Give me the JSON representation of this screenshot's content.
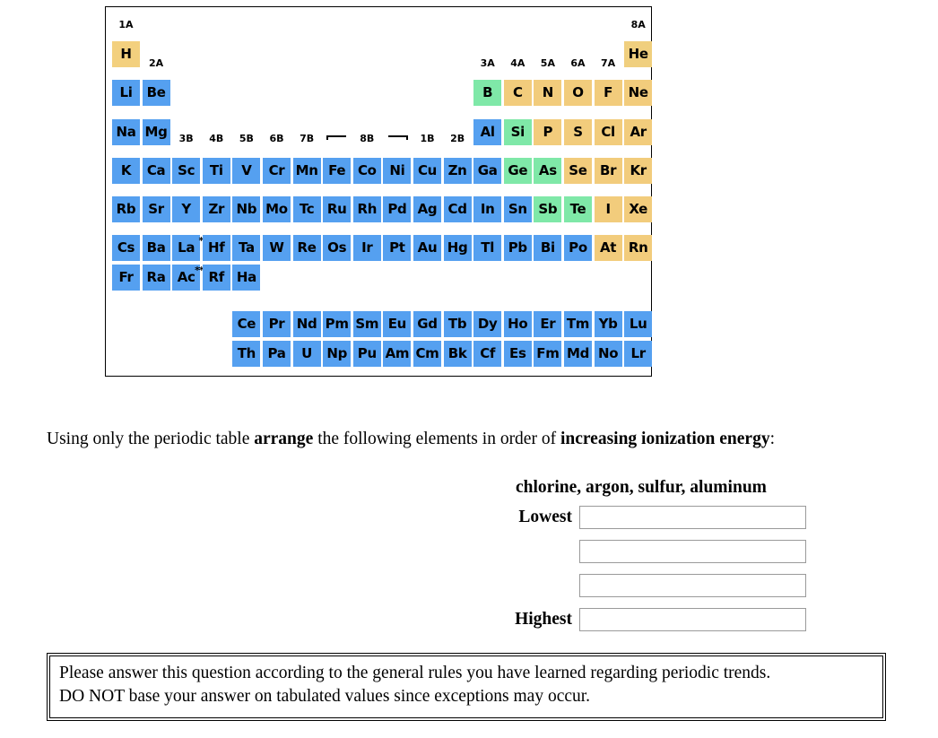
{
  "periodic_table": {
    "legend_colors": {
      "metal": "#55a0f0",
      "metalloid": "#7fe8a8",
      "nonmetal": "#f2cc7c",
      "noble_gas": "#f0cf7e"
    },
    "group_labels": [
      {
        "label": "1A",
        "col": 0,
        "row": "top"
      },
      {
        "label": "2A",
        "col": 1,
        "row": "h"
      },
      {
        "label": "3B",
        "col": 2,
        "row": "na"
      },
      {
        "label": "4B",
        "col": 3,
        "row": "na"
      },
      {
        "label": "5B",
        "col": 4,
        "row": "na"
      },
      {
        "label": "6B",
        "col": 5,
        "row": "na"
      },
      {
        "label": "7B",
        "col": 6,
        "row": "na"
      },
      {
        "label": "8B",
        "col": 8,
        "row": "na"
      },
      {
        "label": "1B",
        "col": 10,
        "row": "na"
      },
      {
        "label": "2B",
        "col": 11,
        "row": "na"
      },
      {
        "label": "3A",
        "col": 12,
        "row": "he"
      },
      {
        "label": "4A",
        "col": 13,
        "row": "he"
      },
      {
        "label": "5A",
        "col": 14,
        "row": "he"
      },
      {
        "label": "6A",
        "col": 15,
        "row": "he"
      },
      {
        "label": "7A",
        "col": 16,
        "row": "he"
      },
      {
        "label": "8A",
        "col": 17,
        "row": "top"
      }
    ],
    "cells": [
      {
        "sym": "H",
        "col": 0,
        "row": 0,
        "type": "hyd"
      },
      {
        "sym": "He",
        "col": 17,
        "row": 0,
        "type": "noble"
      },
      {
        "sym": "Li",
        "col": 0,
        "row": 1,
        "type": "metal"
      },
      {
        "sym": "Be",
        "col": 1,
        "row": 1,
        "type": "metal"
      },
      {
        "sym": "B",
        "col": 12,
        "row": 1,
        "type": "metalloid"
      },
      {
        "sym": "C",
        "col": 13,
        "row": 1,
        "type": "nonmetal"
      },
      {
        "sym": "N",
        "col": 14,
        "row": 1,
        "type": "nonmetal"
      },
      {
        "sym": "O",
        "col": 15,
        "row": 1,
        "type": "nonmetal"
      },
      {
        "sym": "F",
        "col": 16,
        "row": 1,
        "type": "nonmetal"
      },
      {
        "sym": "Ne",
        "col": 17,
        "row": 1,
        "type": "nonmetal"
      },
      {
        "sym": "Na",
        "col": 0,
        "row": 2,
        "type": "metal"
      },
      {
        "sym": "Mg",
        "col": 1,
        "row": 2,
        "type": "metal"
      },
      {
        "sym": "Al",
        "col": 12,
        "row": 2,
        "type": "metal"
      },
      {
        "sym": "Si",
        "col": 13,
        "row": 2,
        "type": "metalloid"
      },
      {
        "sym": "P",
        "col": 14,
        "row": 2,
        "type": "nonmetal"
      },
      {
        "sym": "S",
        "col": 15,
        "row": 2,
        "type": "nonmetal"
      },
      {
        "sym": "Cl",
        "col": 16,
        "row": 2,
        "type": "nonmetal"
      },
      {
        "sym": "Ar",
        "col": 17,
        "row": 2,
        "type": "nonmetal"
      },
      {
        "sym": "K",
        "col": 0,
        "row": 3,
        "type": "metal"
      },
      {
        "sym": "Ca",
        "col": 1,
        "row": 3,
        "type": "metal"
      },
      {
        "sym": "Sc",
        "col": 2,
        "row": 3,
        "type": "metal"
      },
      {
        "sym": "Ti",
        "col": 3,
        "row": 3,
        "type": "metal"
      },
      {
        "sym": "V",
        "col": 4,
        "row": 3,
        "type": "metal"
      },
      {
        "sym": "Cr",
        "col": 5,
        "row": 3,
        "type": "metal"
      },
      {
        "sym": "Mn",
        "col": 6,
        "row": 3,
        "type": "metal"
      },
      {
        "sym": "Fe",
        "col": 7,
        "row": 3,
        "type": "metal"
      },
      {
        "sym": "Co",
        "col": 8,
        "row": 3,
        "type": "metal"
      },
      {
        "sym": "Ni",
        "col": 9,
        "row": 3,
        "type": "metal"
      },
      {
        "sym": "Cu",
        "col": 10,
        "row": 3,
        "type": "metal"
      },
      {
        "sym": "Zn",
        "col": 11,
        "row": 3,
        "type": "metal"
      },
      {
        "sym": "Ga",
        "col": 12,
        "row": 3,
        "type": "metal"
      },
      {
        "sym": "Ge",
        "col": 13,
        "row": 3,
        "type": "metalloid"
      },
      {
        "sym": "As",
        "col": 14,
        "row": 3,
        "type": "metalloid"
      },
      {
        "sym": "Se",
        "col": 15,
        "row": 3,
        "type": "nonmetal"
      },
      {
        "sym": "Br",
        "col": 16,
        "row": 3,
        "type": "nonmetal"
      },
      {
        "sym": "Kr",
        "col": 17,
        "row": 3,
        "type": "nonmetal"
      },
      {
        "sym": "Rb",
        "col": 0,
        "row": 4,
        "type": "metal"
      },
      {
        "sym": "Sr",
        "col": 1,
        "row": 4,
        "type": "metal"
      },
      {
        "sym": "Y",
        "col": 2,
        "row": 4,
        "type": "metal"
      },
      {
        "sym": "Zr",
        "col": 3,
        "row": 4,
        "type": "metal"
      },
      {
        "sym": "Nb",
        "col": 4,
        "row": 4,
        "type": "metal"
      },
      {
        "sym": "Mo",
        "col": 5,
        "row": 4,
        "type": "metal"
      },
      {
        "sym": "Tc",
        "col": 6,
        "row": 4,
        "type": "metal"
      },
      {
        "sym": "Ru",
        "col": 7,
        "row": 4,
        "type": "metal"
      },
      {
        "sym": "Rh",
        "col": 8,
        "row": 4,
        "type": "metal"
      },
      {
        "sym": "Pd",
        "col": 9,
        "row": 4,
        "type": "metal"
      },
      {
        "sym": "Ag",
        "col": 10,
        "row": 4,
        "type": "metal"
      },
      {
        "sym": "Cd",
        "col": 11,
        "row": 4,
        "type": "metal"
      },
      {
        "sym": "In",
        "col": 12,
        "row": 4,
        "type": "metal"
      },
      {
        "sym": "Sn",
        "col": 13,
        "row": 4,
        "type": "metal"
      },
      {
        "sym": "Sb",
        "col": 14,
        "row": 4,
        "type": "metalloid"
      },
      {
        "sym": "Te",
        "col": 15,
        "row": 4,
        "type": "metalloid"
      },
      {
        "sym": "I",
        "col": 16,
        "row": 4,
        "type": "nonmetal"
      },
      {
        "sym": "Xe",
        "col": 17,
        "row": 4,
        "type": "nonmetal"
      },
      {
        "sym": "Cs",
        "col": 0,
        "row": 5,
        "type": "metal"
      },
      {
        "sym": "Ba",
        "col": 1,
        "row": 5,
        "type": "metal"
      },
      {
        "sym": "La",
        "col": 2,
        "row": 5,
        "type": "metal",
        "mark": "*"
      },
      {
        "sym": "Hf",
        "col": 3,
        "row": 5,
        "type": "metal"
      },
      {
        "sym": "Ta",
        "col": 4,
        "row": 5,
        "type": "metal"
      },
      {
        "sym": "W",
        "col": 5,
        "row": 5,
        "type": "metal"
      },
      {
        "sym": "Re",
        "col": 6,
        "row": 5,
        "type": "metal"
      },
      {
        "sym": "Os",
        "col": 7,
        "row": 5,
        "type": "metal"
      },
      {
        "sym": "Ir",
        "col": 8,
        "row": 5,
        "type": "metal"
      },
      {
        "sym": "Pt",
        "col": 9,
        "row": 5,
        "type": "metal"
      },
      {
        "sym": "Au",
        "col": 10,
        "row": 5,
        "type": "metal"
      },
      {
        "sym": "Hg",
        "col": 11,
        "row": 5,
        "type": "metal"
      },
      {
        "sym": "Tl",
        "col": 12,
        "row": 5,
        "type": "metal"
      },
      {
        "sym": "Pb",
        "col": 13,
        "row": 5,
        "type": "metal"
      },
      {
        "sym": "Bi",
        "col": 14,
        "row": 5,
        "type": "metal"
      },
      {
        "sym": "Po",
        "col": 15,
        "row": 5,
        "type": "metal"
      },
      {
        "sym": "At",
        "col": 16,
        "row": 5,
        "type": "nonmetal"
      },
      {
        "sym": "Rn",
        "col": 17,
        "row": 5,
        "type": "nonmetal"
      },
      {
        "sym": "Fr",
        "col": 0,
        "row": 6,
        "type": "metal"
      },
      {
        "sym": "Ra",
        "col": 1,
        "row": 6,
        "type": "metal"
      },
      {
        "sym": "Ac",
        "col": 2,
        "row": 6,
        "type": "metal",
        "mark": "**"
      },
      {
        "sym": "Rf",
        "col": 3,
        "row": 6,
        "type": "metal"
      },
      {
        "sym": "Ha",
        "col": 4,
        "row": 6,
        "type": "metal"
      },
      {
        "sym": "Ce",
        "col": 4,
        "row": 8,
        "type": "metal"
      },
      {
        "sym": "Pr",
        "col": 5,
        "row": 8,
        "type": "metal"
      },
      {
        "sym": "Nd",
        "col": 6,
        "row": 8,
        "type": "metal"
      },
      {
        "sym": "Pm",
        "col": 7,
        "row": 8,
        "type": "metal"
      },
      {
        "sym": "Sm",
        "col": 8,
        "row": 8,
        "type": "metal"
      },
      {
        "sym": "Eu",
        "col": 9,
        "row": 8,
        "type": "metal"
      },
      {
        "sym": "Gd",
        "col": 10,
        "row": 8,
        "type": "metal"
      },
      {
        "sym": "Tb",
        "col": 11,
        "row": 8,
        "type": "metal"
      },
      {
        "sym": "Dy",
        "col": 12,
        "row": 8,
        "type": "metal"
      },
      {
        "sym": "Ho",
        "col": 13,
        "row": 8,
        "type": "metal"
      },
      {
        "sym": "Er",
        "col": 14,
        "row": 8,
        "type": "metal"
      },
      {
        "sym": "Tm",
        "col": 15,
        "row": 8,
        "type": "metal"
      },
      {
        "sym": "Yb",
        "col": 16,
        "row": 8,
        "type": "metal"
      },
      {
        "sym": "Lu",
        "col": 17,
        "row": 8,
        "type": "metal"
      },
      {
        "sym": "Th",
        "col": 4,
        "row": 9,
        "type": "metal"
      },
      {
        "sym": "Pa",
        "col": 5,
        "row": 9,
        "type": "metal"
      },
      {
        "sym": "U",
        "col": 6,
        "row": 9,
        "type": "metal"
      },
      {
        "sym": "Np",
        "col": 7,
        "row": 9,
        "type": "metal"
      },
      {
        "sym": "Pu",
        "col": 8,
        "row": 9,
        "type": "metal"
      },
      {
        "sym": "Am",
        "col": 9,
        "row": 9,
        "type": "metal"
      },
      {
        "sym": "Cm",
        "col": 10,
        "row": 9,
        "type": "metal"
      },
      {
        "sym": "Bk",
        "col": 11,
        "row": 9,
        "type": "metal"
      },
      {
        "sym": "Cf",
        "col": 12,
        "row": 9,
        "type": "metal"
      },
      {
        "sym": "Es",
        "col": 13,
        "row": 9,
        "type": "metal"
      },
      {
        "sym": "Fm",
        "col": 14,
        "row": 9,
        "type": "metal"
      },
      {
        "sym": "Md",
        "col": 15,
        "row": 9,
        "type": "metal"
      },
      {
        "sym": "No",
        "col": 16,
        "row": 9,
        "type": "metal"
      },
      {
        "sym": "Lr",
        "col": 17,
        "row": 9,
        "type": "metal"
      }
    ]
  },
  "question": {
    "part1": "Using only the periodic table ",
    "bold1": "arrange",
    "part2": " the following elements in order of ",
    "bold2": "increasing ionization energy",
    "part3": ":",
    "element_list": "chlorine, argon, sulfur, aluminum"
  },
  "answers": {
    "rows": [
      {
        "label": "Lowest",
        "value": "",
        "placeholder": ""
      },
      {
        "label": "",
        "value": "",
        "placeholder": ""
      },
      {
        "label": "",
        "value": "",
        "placeholder": ""
      },
      {
        "label": "Highest",
        "value": "",
        "placeholder": ""
      }
    ]
  },
  "note": {
    "line1": "Please answer this question according to the general rules you have learned regarding periodic trends.",
    "line2": "DO NOT base your answer on tabulated values since exceptions may occur."
  }
}
